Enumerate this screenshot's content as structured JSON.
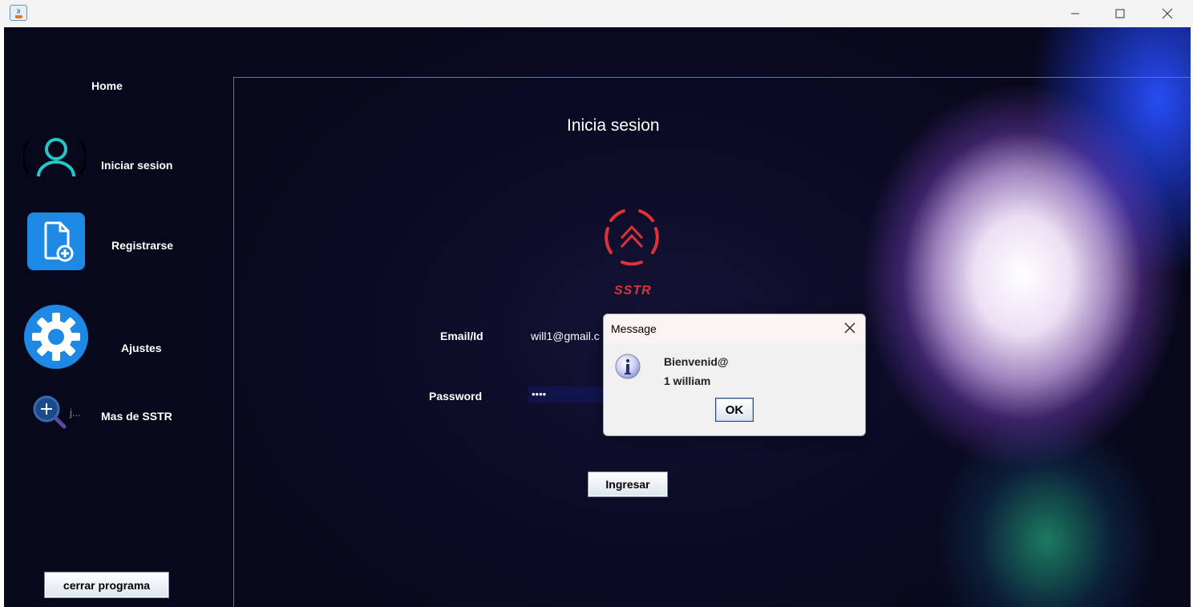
{
  "window": {
    "title": ""
  },
  "sidebar": {
    "home_label": "Home",
    "login_label": "Iniciar sesion",
    "register_label": "Registrarse",
    "settings_label": "Ajustes",
    "more_label": "Mas de SSTR",
    "more_icon_text": "j...",
    "close_program_label": "cerrar programa"
  },
  "login": {
    "title": "Inicia sesion",
    "brand": "SSTR",
    "email_label": "Email/Id",
    "email_value": "will1@gmail.c",
    "password_label": "Password",
    "password_value": "••••",
    "submit_label": "Ingresar"
  },
  "dialog": {
    "title": "Message",
    "line1": "Bienvenid@",
    "line2": "1 william",
    "ok_label": "OK"
  },
  "colors": {
    "brand_red": "#e0303a",
    "background": "#0b0b26",
    "accent_blue": "#1e88e5",
    "accent_teal": "#26c6c6"
  },
  "icons": {
    "login": "user-icon",
    "register": "document-add-icon",
    "settings": "gear-icon",
    "more": "magnifier-icon",
    "dialog": "info-icon"
  }
}
